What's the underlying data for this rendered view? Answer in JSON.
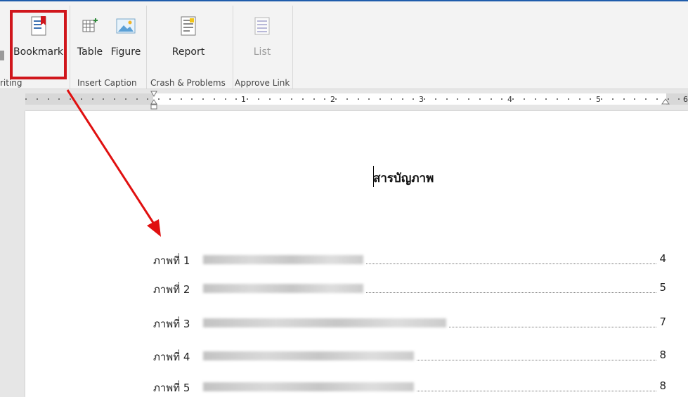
{
  "ribbon": {
    "buttons": [
      {
        "label": "Bookmark",
        "icon": "bookmark-icon",
        "disabled": false
      },
      {
        "label": "Table",
        "icon": "table-caption-icon",
        "disabled": false
      },
      {
        "label": "Figure",
        "icon": "figure-caption-icon",
        "disabled": false
      },
      {
        "label": "Report",
        "icon": "report-icon",
        "disabled": false
      },
      {
        "label": "List",
        "icon": "list-icon",
        "disabled": true
      }
    ],
    "groups": [
      {
        "label": "riting"
      },
      {
        "label": "Insert Caption"
      },
      {
        "label": "Crash & Problems"
      },
      {
        "label": "Approve Link"
      }
    ],
    "highlight_color": "#d0161c"
  },
  "ruler": {
    "numbers": [
      "1",
      "2",
      "3",
      "4",
      "5",
      "6"
    ]
  },
  "document": {
    "title": "สารบัญภาพ",
    "toc": [
      {
        "label": "ภาพที่ 1",
        "page": "4"
      },
      {
        "label": "ภาพที่ 2",
        "page": "5"
      },
      {
        "label": "ภาพที่ 3",
        "page": "7"
      },
      {
        "label": "ภาพที่ 4",
        "page": "8"
      },
      {
        "label": "ภาพที่ 5",
        "page": "8"
      }
    ]
  },
  "annotation": {
    "arrow_color": "#e01010"
  }
}
